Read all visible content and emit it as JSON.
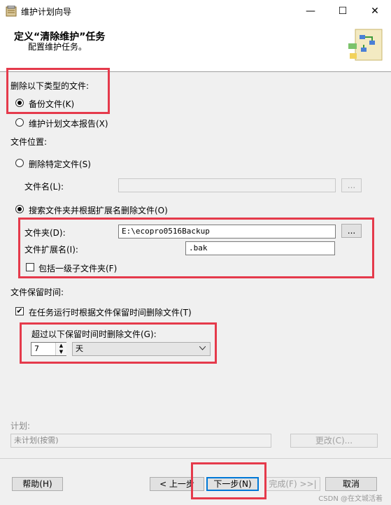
{
  "window": {
    "title": "维护计划向导",
    "minimize_icon": "—",
    "maximize_icon": "☐",
    "close_icon": "✕"
  },
  "header": {
    "title": "定义“清除维护”任务",
    "subtitle": "配置维护任务。"
  },
  "delete_type": {
    "label": "删除以下类型的文件:",
    "option_backup": "备份文件(K)",
    "option_report": "维护计划文本报告(X)",
    "selected": "backup"
  },
  "file_location": {
    "label": "文件位置:",
    "option_specific": "删除特定文件(S)",
    "filename_label": "文件名(L):",
    "filename_value": "",
    "browse_label": "...",
    "option_search": "搜索文件夹并根据扩展名删除文件(O)",
    "folder_label": "文件夹(D):",
    "folder_value": "E:\\ecopro0516Backup",
    "folder_browse_label": "...",
    "ext_label": "文件扩展名(I):",
    "ext_value": ".bak",
    "subfolder_label": "包括一级子文件夹(F)",
    "subfolder_checked": false,
    "selected": "search"
  },
  "retention": {
    "label": "文件保留时间:",
    "checkbox_label": "在任务运行时根据文件保留时间删除文件(T)",
    "checkbox_checked": true,
    "older_than_label": "超过以下保留时间时删除文件(G):",
    "value": "7",
    "unit": "天"
  },
  "schedule": {
    "label": "计划:",
    "value": "未计划(按需)",
    "change_label": "更改(C)..."
  },
  "footer": {
    "help_label": "帮助(H)",
    "back_label": "< 上一步",
    "next_label": "下一步(N)",
    "finish_label": "完成(F) >>|",
    "cancel_label": "取消"
  },
  "watermark": "CSDN @在文城活着",
  "colors": {
    "highlight": "#e53a4b",
    "default_button": "#0078d7"
  }
}
